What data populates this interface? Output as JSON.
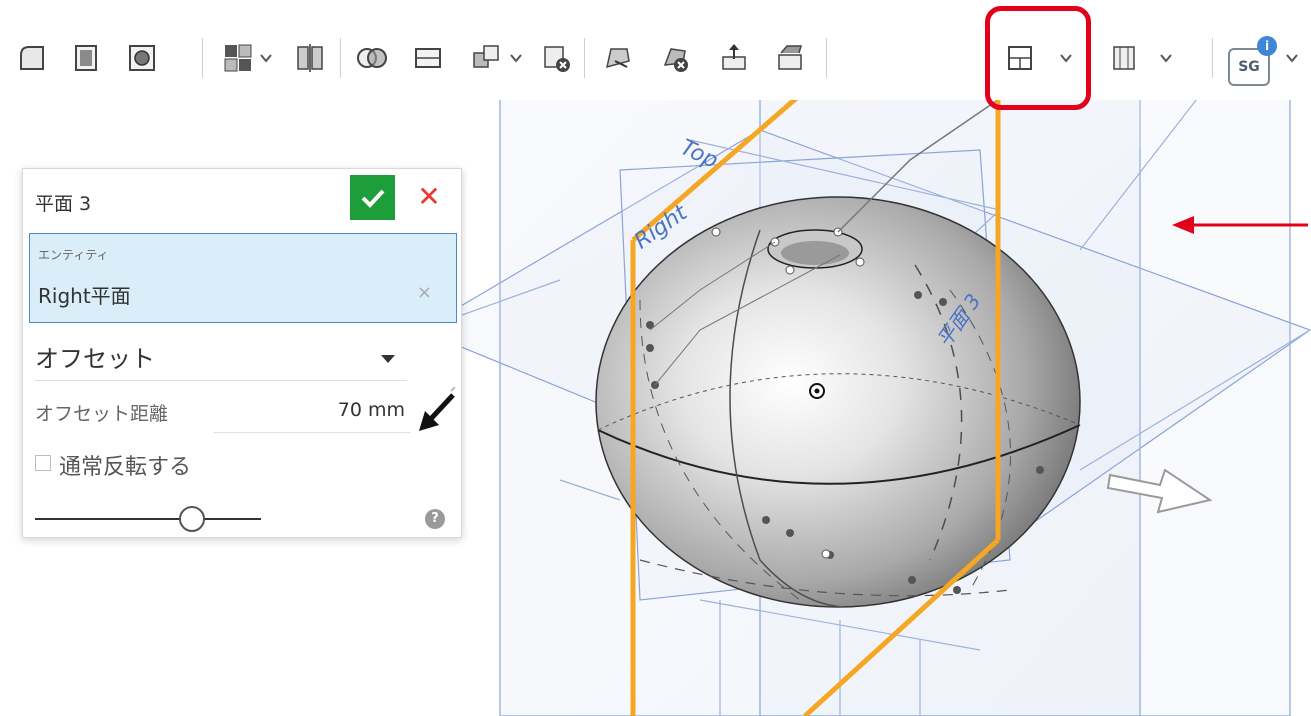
{
  "toolbar": {
    "sg_label": "SG",
    "sg_badge": "i",
    "highlighted_tool": "plane-tool"
  },
  "dialog": {
    "title": "平面 3",
    "entity_caption": "エンティティ",
    "entity_value": "Right平面",
    "entity_clear": "×",
    "mode_value": "オフセット",
    "offset_label": "オフセット距離",
    "offset_value": "70 mm",
    "flip_label": "通常反転する",
    "confirm_glyph": "✔",
    "cancel_glyph": "✕",
    "help_glyph": "?"
  },
  "viewport": {
    "plane_top_label": "Top",
    "plane_right_label": "Right",
    "plane3_label": "平面 3",
    "accent_color": "#f5a623",
    "plane_color": "#5f83c6",
    "annotation_color": "#e3001b"
  }
}
